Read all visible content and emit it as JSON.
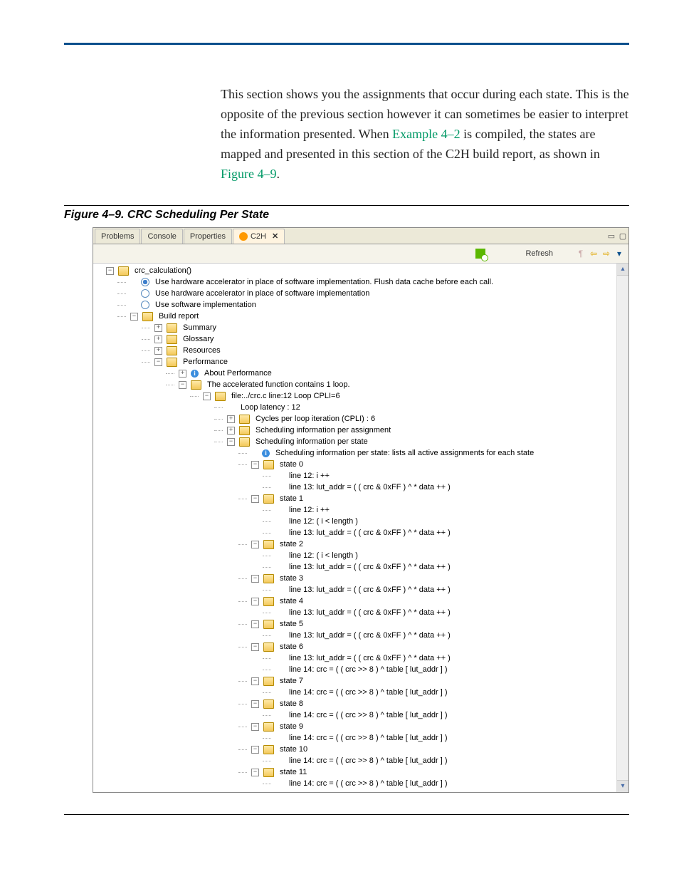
{
  "doc": {
    "paragraph_a": "This section shows you the assignments that occur during each state. This is the opposite of the previous section however it can sometimes be easier to interpret the information presented. When ",
    "ref1": "Example 4–2",
    "paragraph_b": " is compiled, the states are mapped and presented in this section of the C2H build report, as shown in ",
    "ref2": "Figure 4–9",
    "paragraph_c": "."
  },
  "caption": "Figure 4–9. CRC Scheduling Per State",
  "tabs": {
    "problems": "Problems",
    "console": "Console",
    "properties": "Properties",
    "c2h": "C2H",
    "close": "✕",
    "min": "▭",
    "max": "▢"
  },
  "toolbar": {
    "refresh": "Refresh",
    "t_add": "＋",
    "t_wrap": "¶",
    "t_back": "⇦",
    "t_fwd": "⇨",
    "t_menu": "▾"
  },
  "scroll": {
    "up": "▴",
    "down": "▾"
  },
  "tree": {
    "root": "crc_calculation()",
    "opt1": "Use hardware accelerator in place of software implementation. Flush data cache before each call.",
    "opt2": "Use hardware accelerator in place of software implementation",
    "opt3": "Use software implementation",
    "build_report": "Build report",
    "summary": "Summary",
    "glossary": "Glossary",
    "resources": "Resources",
    "performance": "Performance",
    "about_perf": "About Performance",
    "accel_loop": "The accelerated function contains 1 loop.",
    "file_line": "file:../crc.c line:12 Loop CPLI=6",
    "loop_latency": "Loop latency :  12",
    "cycles": "Cycles per loop iteration (CPLI) : 6",
    "sched_assign": "Scheduling information per assignment",
    "sched_state": "Scheduling information per state",
    "sched_info": "Scheduling information per state: lists all active assignments for each state",
    "l12_inc": "line 12: i ++",
    "l12_cond": "line 12: ( i < length )",
    "l13_lut": "line 13: lut_addr = ( ( crc & 0xFF ) ^  * data ++  )",
    "l14_crc": "line 14: crc = ( ( crc >> 8 ) ^ table [ lut_addr ] )",
    "states": [
      "state 0",
      "state 1",
      "state 2",
      "state 3",
      "state 4",
      "state 5",
      "state 6",
      "state 7",
      "state 8",
      "state 9",
      "state 10",
      "state 11"
    ]
  }
}
